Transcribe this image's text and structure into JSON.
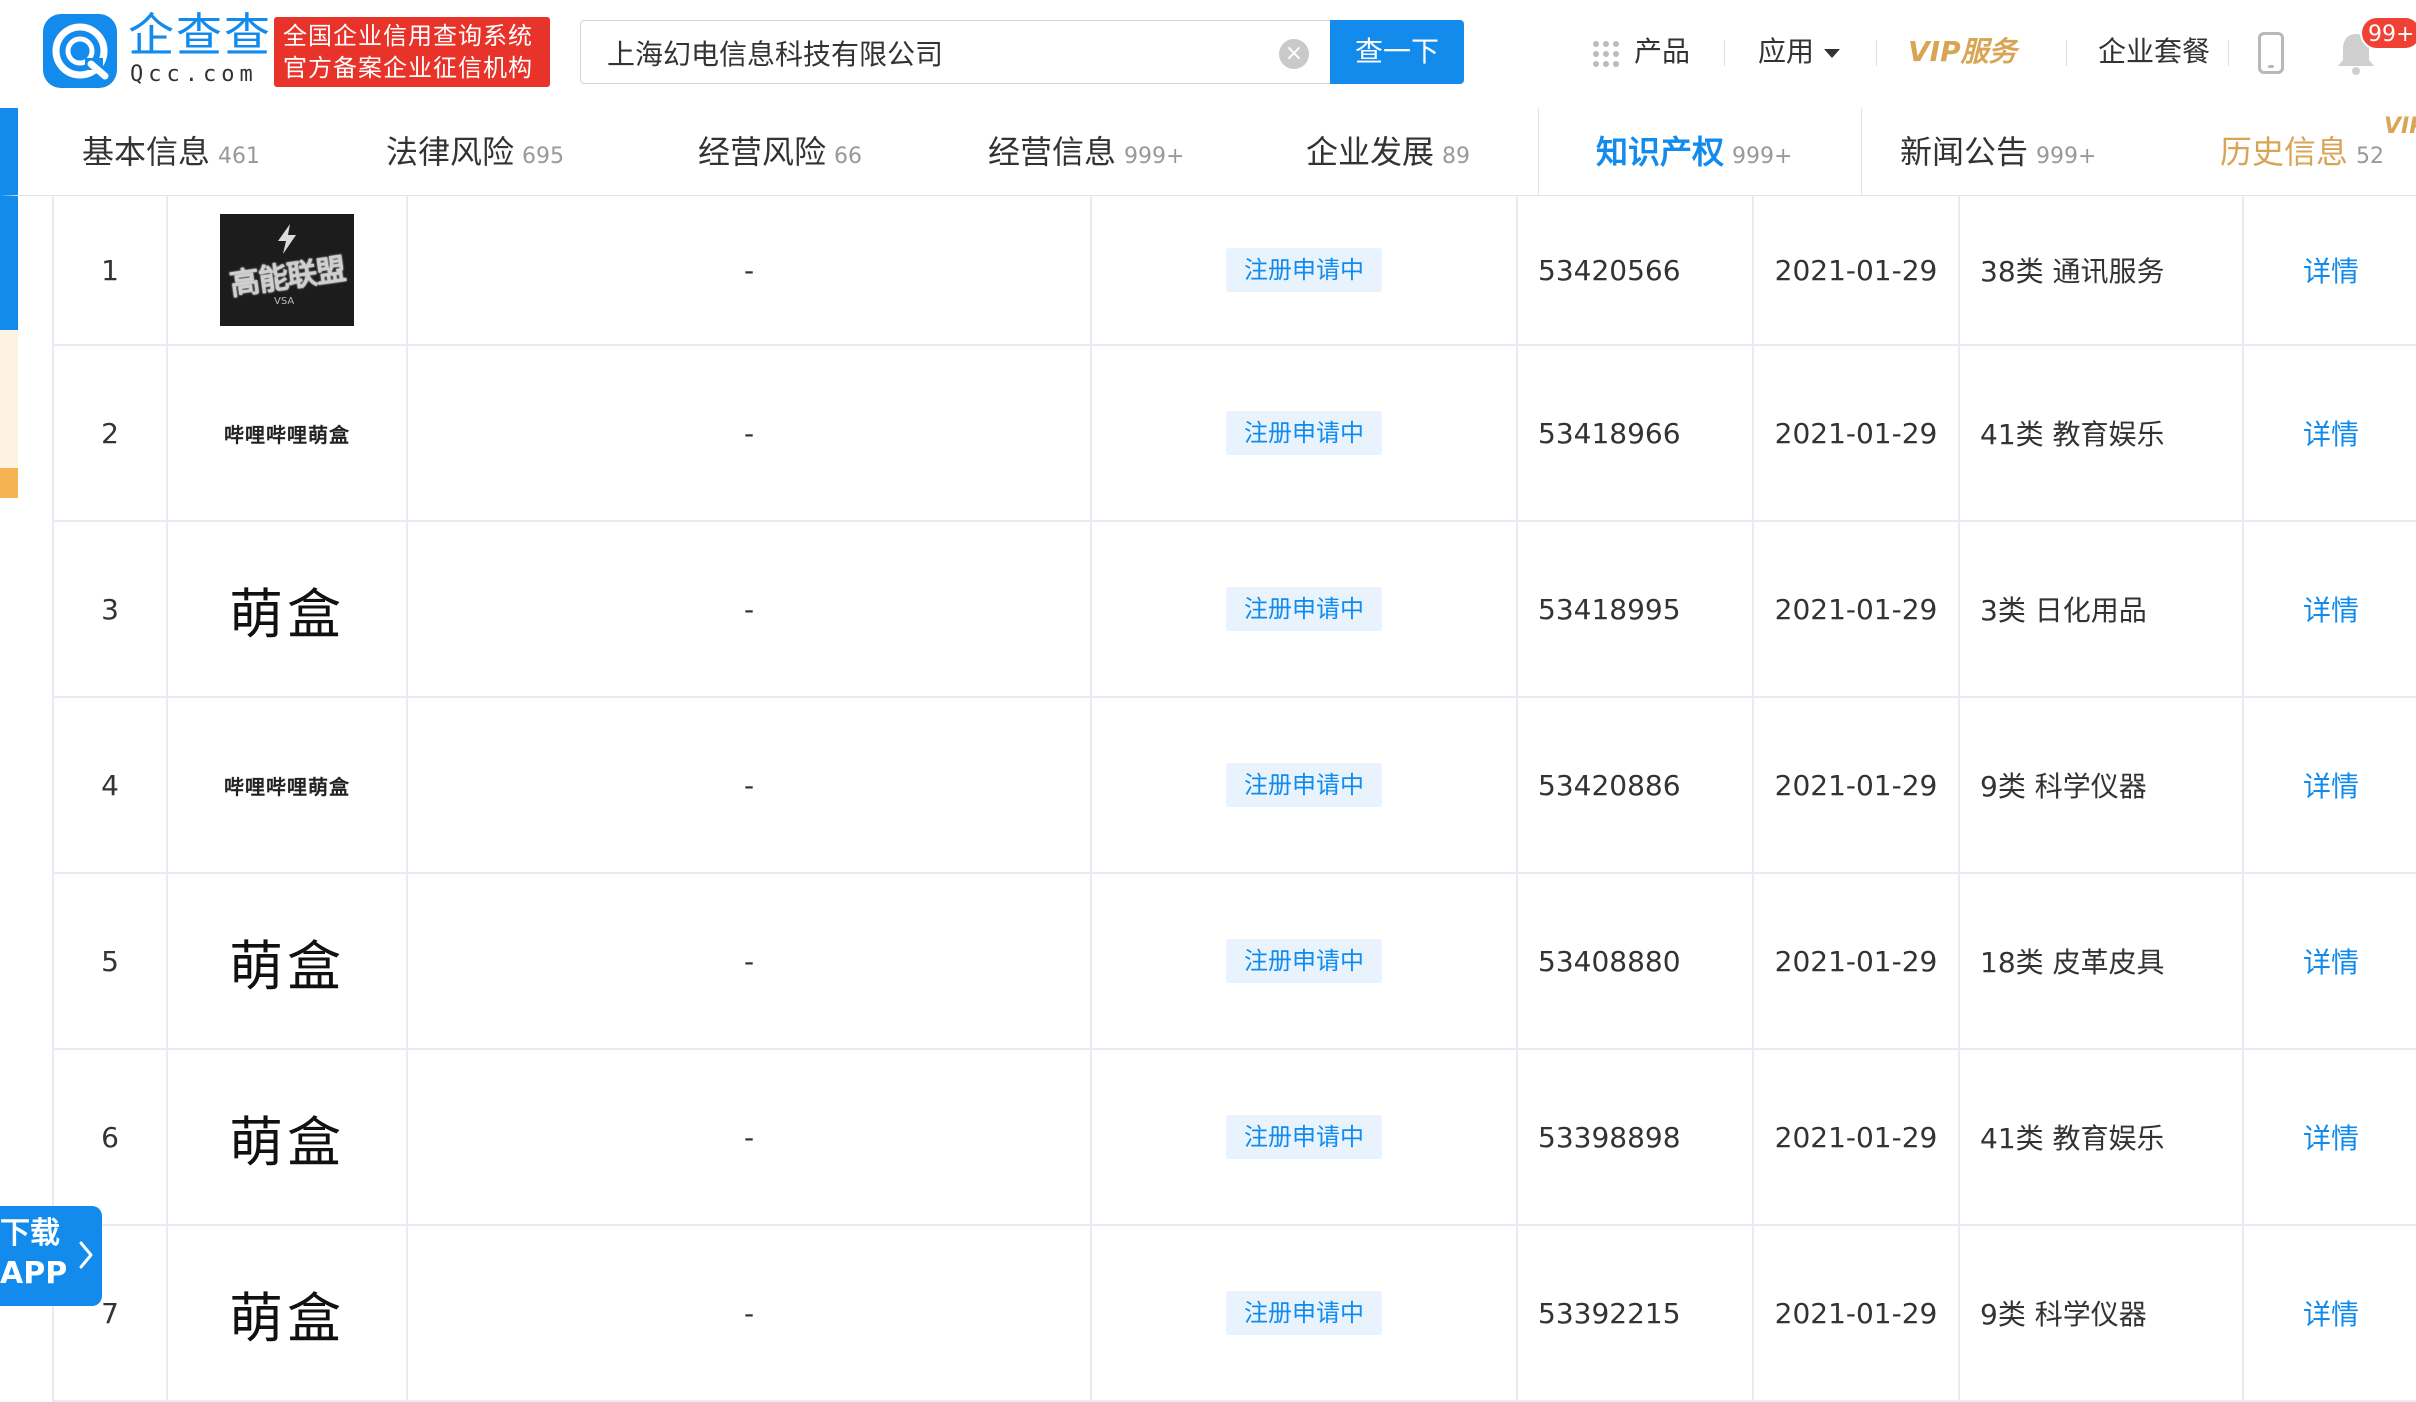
{
  "header": {
    "logo_name": "企查查",
    "logo_sub": "Qcc.com",
    "cert_line1": "全国企业信用查询系统",
    "cert_line2": "官方备案企业征信机构",
    "search_value": "上海幻电信息科技有限公司",
    "search_button": "查一下",
    "nav": {
      "products": "产品",
      "apps": "应用",
      "vip": "VIP服务",
      "packages": "企业套餐"
    },
    "notification_count": "99+"
  },
  "tabs": [
    {
      "label": "基本信息",
      "count": "461"
    },
    {
      "label": "法律风险",
      "count": "695"
    },
    {
      "label": "经营风险",
      "count": "66"
    },
    {
      "label": "经营信息",
      "count": "999+"
    },
    {
      "label": "企业发展",
      "count": "89"
    },
    {
      "label": "知识产权",
      "count": "999+"
    },
    {
      "label": "新闻公告",
      "count": "999+"
    },
    {
      "label": "历史信息",
      "count": "52"
    }
  ],
  "vip_tag": "VIP",
  "rows": [
    {
      "index": "1",
      "trademark": "高能联盟",
      "trademark_sub": "VSA",
      "applicant": "-",
      "status": "注册申请中",
      "reg_no": "53420566",
      "date": "2021-01-29",
      "category": "38类 通讯服务",
      "detail": "详情"
    },
    {
      "index": "2",
      "trademark": "哔哩哔哩萌盒",
      "applicant": "-",
      "status": "注册申请中",
      "reg_no": "53418966",
      "date": "2021-01-29",
      "category": "41类 教育娱乐",
      "detail": "详情"
    },
    {
      "index": "3",
      "trademark": "萌盒",
      "applicant": "-",
      "status": "注册申请中",
      "reg_no": "53418995",
      "date": "2021-01-29",
      "category": "3类 日化用品",
      "detail": "详情"
    },
    {
      "index": "4",
      "trademark": "哔哩哔哩萌盒",
      "applicant": "-",
      "status": "注册申请中",
      "reg_no": "53420886",
      "date": "2021-01-29",
      "category": "9类 科学仪器",
      "detail": "详情"
    },
    {
      "index": "5",
      "trademark": "萌盒",
      "applicant": "-",
      "status": "注册申请中",
      "reg_no": "53408880",
      "date": "2021-01-29",
      "category": "18类 皮革皮具",
      "detail": "详情"
    },
    {
      "index": "6",
      "trademark": "萌盒",
      "applicant": "-",
      "status": "注册申请中",
      "reg_no": "53398898",
      "date": "2021-01-29",
      "category": "41类 教育娱乐",
      "detail": "详情"
    },
    {
      "index": "7",
      "trademark": "萌盒",
      "applicant": "-",
      "status": "注册申请中",
      "reg_no": "53392215",
      "date": "2021-01-29",
      "category": "9类 科学仪器",
      "detail": "详情"
    }
  ],
  "download": {
    "line1": "下载",
    "line2": "APP"
  },
  "colors": {
    "brand": "#128bed",
    "vip": "#d8a555",
    "badge_red": "#e8332a"
  }
}
